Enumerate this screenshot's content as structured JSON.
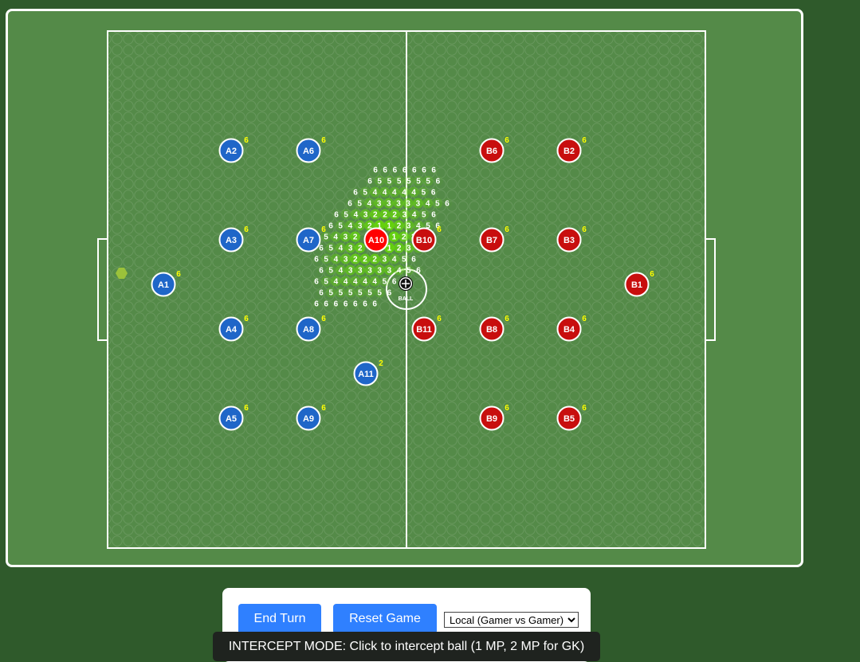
{
  "teams": {
    "home": {
      "color": "#1f66c8",
      "players": [
        {
          "id": "A1",
          "mp": "6"
        },
        {
          "id": "A2",
          "mp": "6"
        },
        {
          "id": "A3",
          "mp": "6"
        },
        {
          "id": "A4",
          "mp": "6"
        },
        {
          "id": "A5",
          "mp": "6"
        },
        {
          "id": "A6",
          "mp": "6"
        },
        {
          "id": "A7",
          "mp": "6"
        },
        {
          "id": "A8",
          "mp": "6"
        },
        {
          "id": "A9",
          "mp": "6"
        },
        {
          "id": "A10",
          "mp": "",
          "selected": true
        },
        {
          "id": "A11",
          "mp": "2"
        }
      ]
    },
    "away": {
      "color": "#c80e0e",
      "players": [
        {
          "id": "B1",
          "mp": "6"
        },
        {
          "id": "B2",
          "mp": "6"
        },
        {
          "id": "B3",
          "mp": "6"
        },
        {
          "id": "B4",
          "mp": "6"
        },
        {
          "id": "B5",
          "mp": "6"
        },
        {
          "id": "B6",
          "mp": "6"
        },
        {
          "id": "B7",
          "mp": "6"
        },
        {
          "id": "B8",
          "mp": "6"
        },
        {
          "id": "B9",
          "mp": "6"
        },
        {
          "id": "B10",
          "mp": "6"
        },
        {
          "id": "B11",
          "mp": "6"
        }
      ]
    }
  },
  "ball": {
    "label": "BALL"
  },
  "colors": {
    "pitch": "#548a48",
    "lines": "#ffffff",
    "mp_text": "#ffff00",
    "range_highlight": "#66e000",
    "selected_player": "#ff0000",
    "button": "#2f80ff",
    "status_bg": "#1f231f"
  },
  "movement_range_rows": [
    [
      "6",
      "6",
      "6",
      "6",
      "6",
      "6",
      "6"
    ],
    [
      "6",
      "5",
      "5",
      "5",
      "5",
      "5",
      "5",
      "6"
    ],
    [
      "6",
      "5",
      "4",
      "4",
      "4",
      "4",
      "4",
      "5",
      "6"
    ],
    [
      "6",
      "5",
      "4",
      "3",
      "3",
      "3",
      "3",
      "3",
      "4",
      "5",
      "6"
    ],
    [
      "6",
      "5",
      "4",
      "3",
      "2",
      "2",
      "2",
      "3",
      "4",
      "5",
      "6"
    ],
    [
      "6",
      "5",
      "4",
      "3",
      "2",
      "1",
      "1",
      "2",
      "3",
      "4",
      "5",
      "6"
    ],
    [
      "5",
      "4",
      "3",
      "2",
      "",
      "",
      "",
      "1",
      "2",
      "3"
    ],
    [
      "6",
      "5",
      "4",
      "3",
      "2",
      "",
      "",
      "1",
      "2",
      "3",
      "4"
    ],
    [
      "6",
      "5",
      "4",
      "3",
      "2",
      "2",
      "2",
      "3",
      "4",
      "5",
      "6"
    ],
    [
      "6",
      "5",
      "4",
      "3",
      "3",
      "3",
      "3",
      "3",
      "4",
      "5",
      "6"
    ],
    [
      "6",
      "5",
      "4",
      "4",
      "4",
      "4",
      "4",
      "5",
      "6"
    ],
    [
      "6",
      "5",
      "5",
      "5",
      "5",
      "5",
      "5",
      "6"
    ],
    [
      "6",
      "6",
      "6",
      "6",
      "6",
      "6",
      "6"
    ]
  ],
  "controls": {
    "end_turn": "End Turn",
    "reset_game": "Reset Game",
    "mode_selected": "Local (Gamer vs Gamer)"
  },
  "status": "INTERCEPT MODE: Click to intercept ball (1 MP, 2 MP for GK)"
}
